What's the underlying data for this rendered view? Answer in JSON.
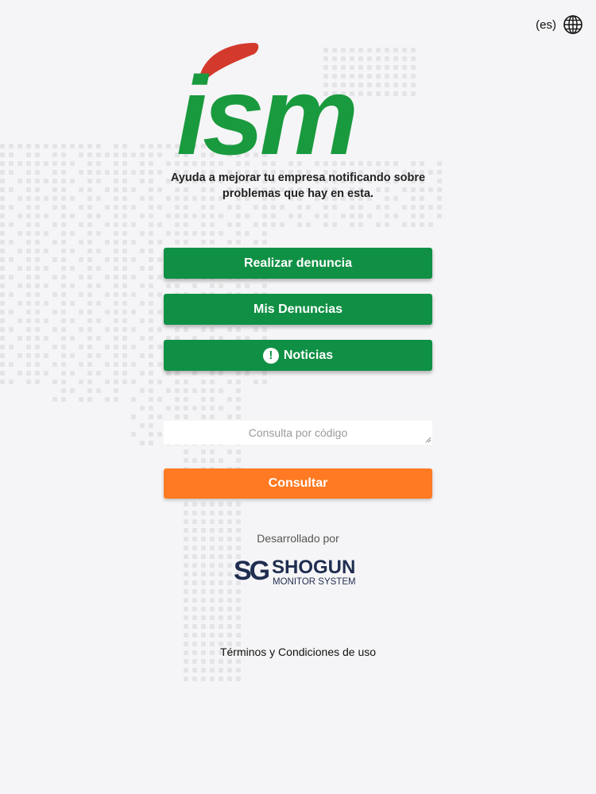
{
  "language": {
    "code": "(es)",
    "icon": "globe-icon"
  },
  "logo": {
    "text": "ism",
    "colors": {
      "green": "#1a9a3e",
      "red": "#d33a2c"
    }
  },
  "tagline": "Ayuda a mejorar tu empresa notificando sobre\nproblemas que hay en esta.",
  "actions": {
    "report_label": "Realizar denuncia",
    "my_reports_label": "Mis Denuncias",
    "news_label": "Noticias",
    "news_icon": "alert-circle-icon"
  },
  "lookup": {
    "placeholder": "Consulta por código",
    "value": "",
    "submit_label": "Consultar"
  },
  "footer": {
    "developed_by": "Desarrollado por",
    "company_logo": {
      "mark": "SG",
      "name": "SHOGUN",
      "tagline": "MONITOR SYSTEM"
    },
    "terms_label": "Términos y Condiciones de uso"
  },
  "colors": {
    "primary_green": "#109044",
    "accent_orange": "#ff7a22",
    "background": "#f5f5f7",
    "brand_navy": "#1f2d4f"
  }
}
